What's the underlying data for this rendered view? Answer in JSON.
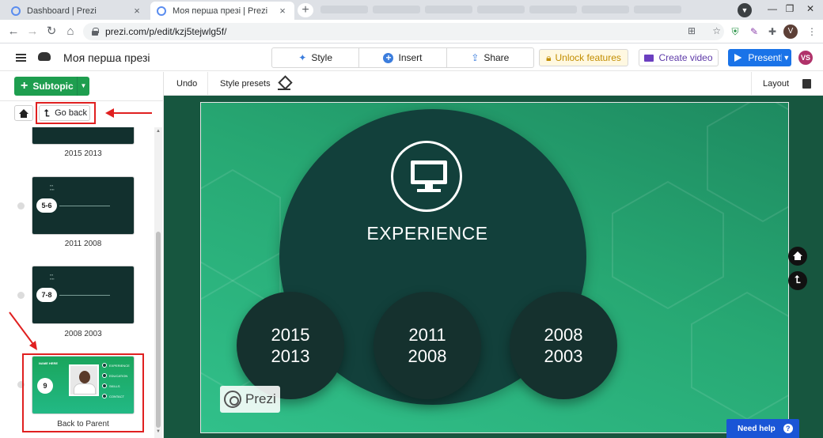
{
  "browser": {
    "tabs": [
      {
        "title": "Dashboard | Prezi",
        "active": false
      },
      {
        "title": "Моя перша презі | Prezi",
        "active": true
      }
    ],
    "new_tab": "+",
    "url": "prezi.com/p/edit/kzj5tejwlg5f/",
    "profile_initial": "V",
    "window_controls": [
      "—",
      "❐",
      "✕"
    ]
  },
  "topbar": {
    "doc_title": "Моя перша презі",
    "buttons": {
      "style": "Style",
      "insert": "Insert",
      "share": "Share"
    },
    "unlock_label": "Unlock features",
    "create_video_label": "Create video",
    "present_label": "Present",
    "user_initials": "VS"
  },
  "sidebar": {
    "subtopic_label": "Subtopic",
    "go_back_label": "Go back",
    "items": [
      {
        "label": "2015 2013",
        "number": ""
      },
      {
        "label": "2011 2008",
        "number": "5-6"
      },
      {
        "label": "2008 2003",
        "number": "7-8"
      },
      {
        "label": "Back to Parent",
        "number": "9"
      }
    ],
    "mini_cv": {
      "name": "NAME HERE",
      "menu": [
        "EXPERIENCE",
        "EDUCATION",
        "SKILLS",
        "CONTACT"
      ]
    }
  },
  "subbar": {
    "undo": "Undo",
    "style_presets": "Style presets",
    "layout": "Layout"
  },
  "slide": {
    "title": "EXPERIENCE",
    "circles": [
      {
        "line1": "2015",
        "line2": "2013"
      },
      {
        "line1": "2011",
        "line2": "2008"
      },
      {
        "line1": "2008",
        "line2": "2003"
      }
    ],
    "logo_text": "Prezi"
  },
  "help": {
    "label": "Need help",
    "icon": "?"
  },
  "colors": {
    "accent_green": "#1e9e4f",
    "present_blue": "#1a73e8",
    "annotation_red": "#e02020",
    "slide_dark": "#12403b"
  }
}
